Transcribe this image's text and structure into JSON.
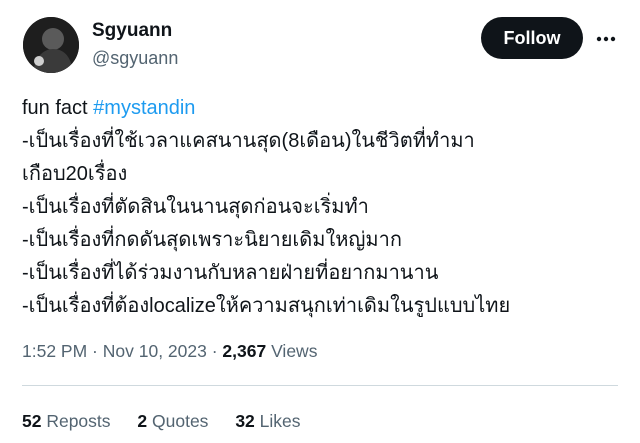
{
  "author": {
    "name": "Sgyuann",
    "handle": "@sgyuann"
  },
  "actions": {
    "follow_label": "Follow",
    "more_icon": "more-horizontal-icon"
  },
  "tweet": {
    "line1_text": "fun fact ",
    "hashtag": "#mystandin",
    "lines": [
      "-เป็นเรื่องที่ใช้เวลาแคสนานสุด(8เดือน)ในชีวิตที่ทำมา",
      "เกือบ20เรื่อง",
      "-เป็นเรื่องที่ตัดสินในนานสุดก่อนจะเริ่มทำ",
      "-เป็นเรื่องที่กดดันสุดเพราะนิยายเดิมใหญ่มาก",
      "-เป็นเรื่องที่ได้ร่วมงานกับหลายฝ่ายที่อยากมานาน",
      "-เป็นเรื่องที่ต้องlocalizeให้ความสนุกเท่าเดิมในรูปแบบไทย"
    ]
  },
  "meta": {
    "time": "1:52 PM",
    "sep1": " · ",
    "date": "Nov 10, 2023",
    "sep2": " · ",
    "views_count": "2,367",
    "views_label": " Views"
  },
  "stats": {
    "reposts_count": "52",
    "reposts_label": " Reposts",
    "quotes_count": "2",
    "quotes_label": " Quotes",
    "likes_count": "32",
    "likes_label": " Likes"
  },
  "colors": {
    "link": "#1d9bf0",
    "text": "#0f1419",
    "secondary": "#536471",
    "divider": "#cfd9de"
  }
}
